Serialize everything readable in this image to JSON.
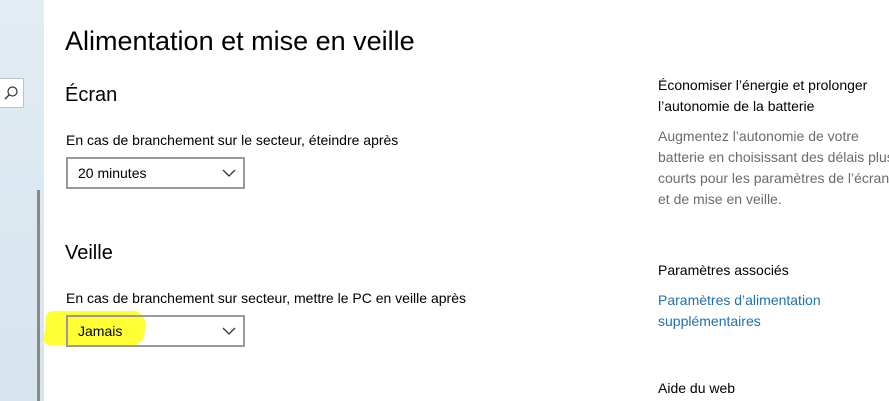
{
  "page": {
    "title": "Alimentation et mise en veille"
  },
  "screen": {
    "heading": "Écran",
    "label": "En cas de branchement sur le secteur, éteindre après",
    "value": "20 minutes"
  },
  "sleep": {
    "heading": "Veille",
    "label": "En cas de branchement sur secteur, mettre le PC en veille après",
    "value": "Jamais"
  },
  "side": {
    "tip_heading": "Économiser l’énergie et prolonger l’autonomie de la batterie",
    "tip_text": "Augmentez l’autonomie de votre batterie en choisissant des délais plus courts pour les paramètres de l’écran et de mise en veille.",
    "related_heading": "Paramètres associés",
    "related_link": "Paramètres d’alimentation supplémentaires",
    "web_help_heading": "Aide du web"
  },
  "icons": {
    "search": "search-icon",
    "dropdown": "chevron-down-icon"
  },
  "colors": {
    "link": "#1f6fb2",
    "highlight": "#ffff33",
    "secondary_text": "#6b6b6b",
    "sidebar": "#dde8f0"
  }
}
